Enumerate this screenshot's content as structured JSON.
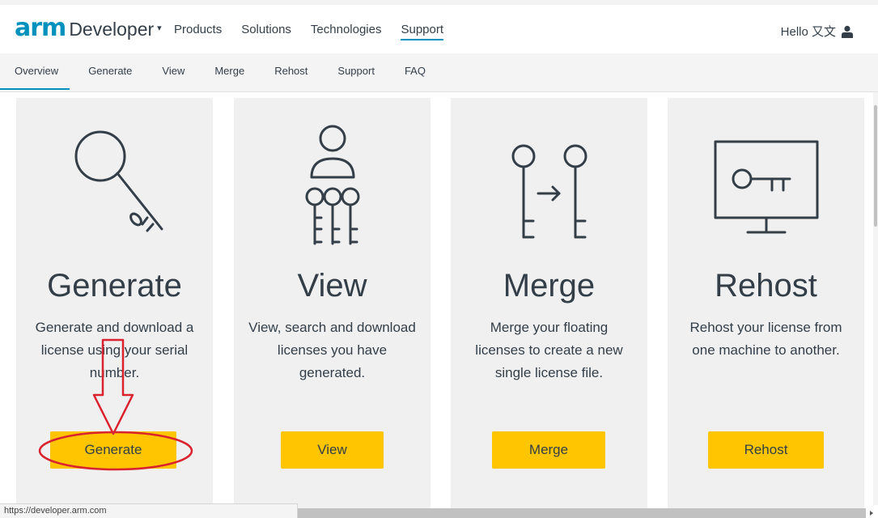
{
  "header": {
    "logo_arm": "arm",
    "logo_developer": "Developer",
    "logo_caret": "▾",
    "nav": [
      {
        "label": "Products"
      },
      {
        "label": "Solutions"
      },
      {
        "label": "Technologies"
      },
      {
        "label": "Support",
        "active": true
      }
    ],
    "greeting": "Hello 又文",
    "user_icon": "user-icon"
  },
  "subnav": {
    "items": [
      {
        "label": "Overview",
        "active": true
      },
      {
        "label": "Generate"
      },
      {
        "label": "View"
      },
      {
        "label": "Merge"
      },
      {
        "label": "Rehost"
      },
      {
        "label": "Support"
      },
      {
        "label": "FAQ"
      }
    ]
  },
  "cards": [
    {
      "icon": "key-icon",
      "title": "Generate",
      "description": "Generate and download a license using your serial number.",
      "button": "Generate"
    },
    {
      "icon": "user-keys-icon",
      "title": "View",
      "description": "View, search and download licenses you have generated.",
      "button": "View"
    },
    {
      "icon": "merge-keys-icon",
      "title": "Merge",
      "description": "Merge your floating licenses to create a new single license file.",
      "button": "Merge"
    },
    {
      "icon": "monitor-key-icon",
      "title": "Rehost",
      "description": "Rehost your license from one machine to another.",
      "button": "Rehost"
    }
  ],
  "annotation": {
    "arrow_color": "#d9232e",
    "target": "Generate"
  },
  "status_bar": {
    "url": "https://developer.arm.com"
  },
  "colors": {
    "brand_blue": "#0091bd",
    "button_yellow": "#ffc600",
    "card_bg": "#f0f0f0",
    "text_dark": "#333e48"
  }
}
